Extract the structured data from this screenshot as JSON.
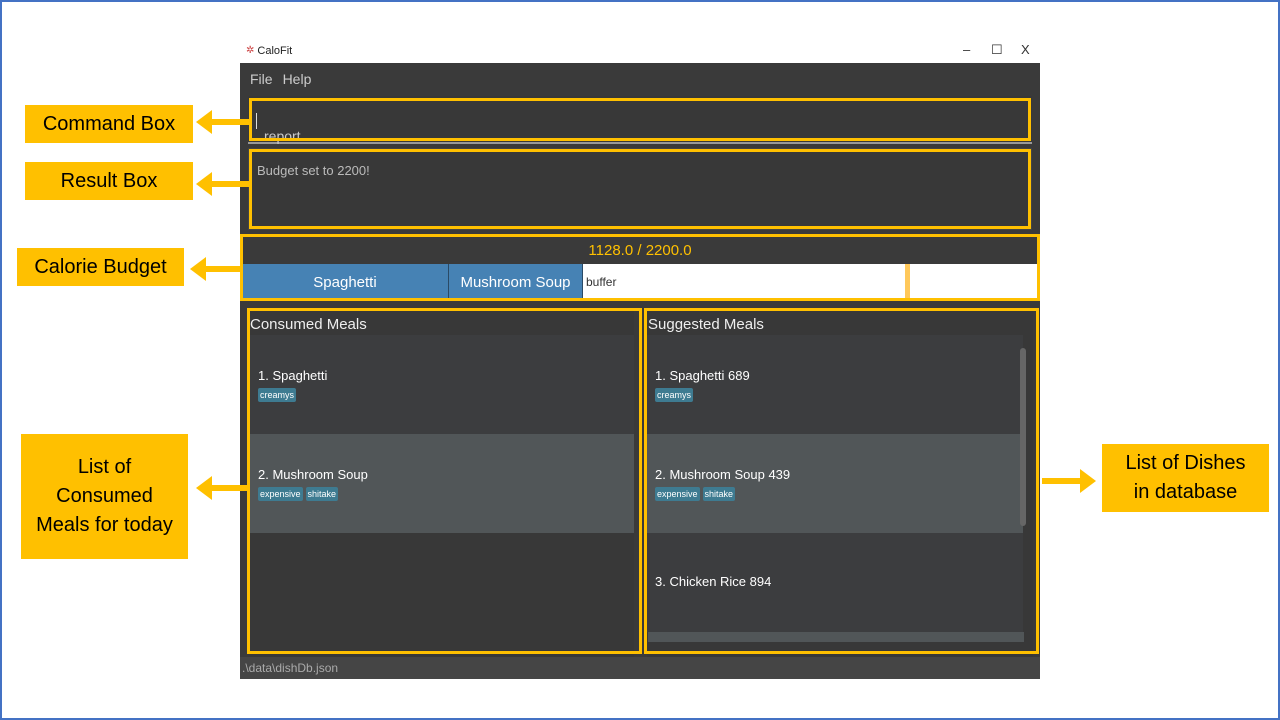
{
  "window": {
    "title": "CaloFit",
    "minimize": "–",
    "maximize": "☐",
    "close": "X"
  },
  "menu": {
    "file": "File",
    "help": "Help"
  },
  "command_box": {
    "value": "report"
  },
  "result_box": {
    "text": "Budget set to 2200!"
  },
  "budget": {
    "text": "1128.0 / 2200.0",
    "consumed": 1128.0,
    "total": 2200.0,
    "segments": [
      "Spaghetti",
      "Mushroom Soup"
    ],
    "buffer_label": "buffer",
    "accent": "#ffc000",
    "segment_color": "#4682b4"
  },
  "consumed": {
    "title": "Consumed Meals",
    "items": [
      {
        "name": "1.  Spaghetti",
        "tags": [
          "creamys"
        ]
      },
      {
        "name": "2.  Mushroom Soup",
        "tags": [
          "expensive",
          "shitake"
        ]
      }
    ]
  },
  "suggested": {
    "title": "Suggested Meals",
    "items": [
      {
        "name": "1.  Spaghetti 689",
        "tags": [
          "creamys"
        ]
      },
      {
        "name": "2.  Mushroom Soup 439",
        "tags": [
          "expensive",
          "shitake"
        ]
      },
      {
        "name": "3.  Chicken Rice 894",
        "tags": []
      }
    ]
  },
  "status_bar": {
    "path": ".\\data\\dishDb.json"
  },
  "callouts": {
    "command_box": "Command Box",
    "result_box": "Result Box",
    "calorie_budget": "Calorie Budget",
    "consumed_list": "List of Consumed Meals for today",
    "dishes_list": "List of Dishes in database"
  }
}
